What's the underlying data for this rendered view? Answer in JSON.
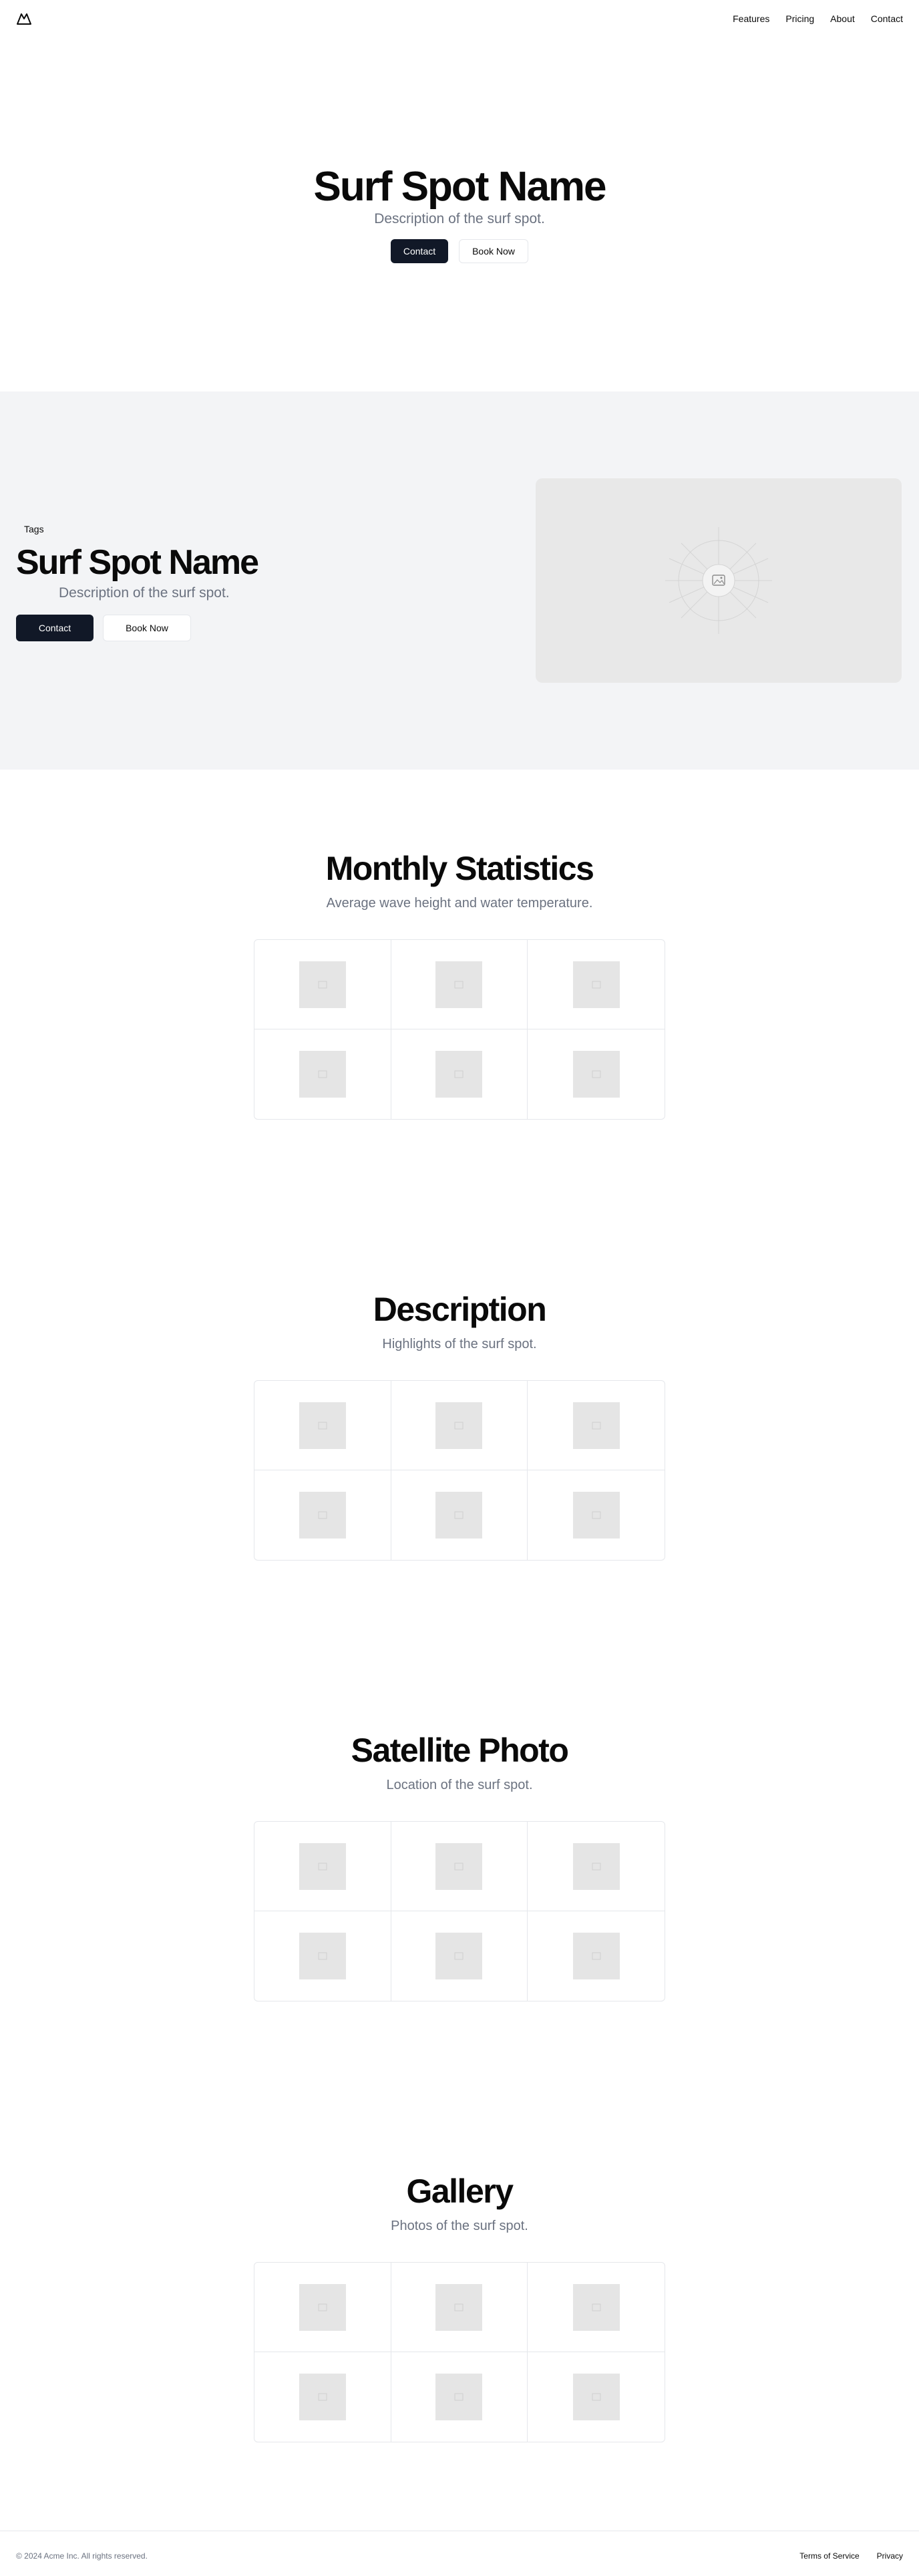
{
  "nav": {
    "logo_icon": "mountain-logo-icon",
    "links": [
      "Features",
      "Pricing",
      "About",
      "Contact"
    ]
  },
  "hero": {
    "title": "Surf Spot Name",
    "description": "Description of the surf spot.",
    "primary_button": "Contact",
    "secondary_button": "Book Now"
  },
  "feature": {
    "tag": "Tags",
    "title": "Surf Spot Name",
    "description": "Description of the surf spot.",
    "primary_button": "Contact",
    "secondary_button": "Book Now",
    "image_icon": "image-placeholder-icon"
  },
  "sections": [
    {
      "title": "Monthly Statistics",
      "subtitle": "Average wave height and water temperature."
    },
    {
      "title": "Description",
      "subtitle": "Highlights of the surf spot."
    },
    {
      "title": "Satellite Photo",
      "subtitle": "Location of the surf spot."
    },
    {
      "title": "Gallery",
      "subtitle": "Photos of the surf spot."
    }
  ],
  "footer": {
    "copyright": "© 2024 Acme Inc. All rights reserved.",
    "links": [
      "Terms of Service",
      "Privacy"
    ]
  },
  "colors": {
    "primary_button_bg": "#111827",
    "muted_text": "#6b7280",
    "section_bg": "#f3f4f6",
    "placeholder": "#e5e5e5"
  }
}
